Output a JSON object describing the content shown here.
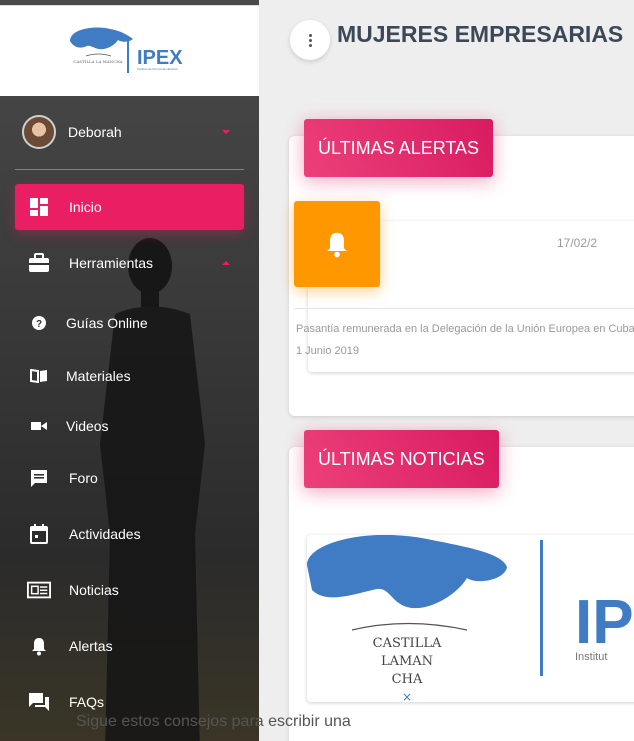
{
  "brand": {
    "logo_text": "IPEX",
    "logo_subtitle": "Instituto de Promoción Exterior",
    "logo_region": "CASTILLA LA MANCHA"
  },
  "user": {
    "name": "Deborah"
  },
  "sidebar": {
    "items": [
      {
        "label": "Inicio",
        "icon": "dashboard-icon",
        "active": true
      },
      {
        "label": "Herramientas",
        "icon": "briefcase-icon",
        "expanded": true
      },
      {
        "label": "Guías Online",
        "icon": "help-circle-icon"
      },
      {
        "label": "Materiales",
        "icon": "book-icon"
      },
      {
        "label": "Videos",
        "icon": "videocam-icon"
      },
      {
        "label": "Foro",
        "icon": "forum-icon"
      },
      {
        "label": "Actividades",
        "icon": "calendar-icon"
      },
      {
        "label": "Noticias",
        "icon": "newspaper-icon"
      },
      {
        "label": "Alertas",
        "icon": "bell-icon"
      },
      {
        "label": "FAQs",
        "icon": "chat-icon"
      }
    ]
  },
  "header": {
    "title": "MUJERES EMPRESARIAS"
  },
  "alerts": {
    "title": "ÚLTIMAS ALERTAS",
    "date": "17/02/2",
    "text": "Pasantía remunerada en la Delegación de la Unión Europea en Cuba 1 Junio 2019"
  },
  "news": {
    "title": "ÚLTIMAS NOTICIAS",
    "image_region_lines": [
      "CASTILLA",
      "LAMAN",
      "CHA"
    ],
    "image_brand": "IPEX",
    "image_brand_sub": "Institut",
    "text": "Sigue estos consejos para escribir una"
  },
  "colors": {
    "accent": "#e91e63",
    "warning": "#ff9800",
    "logo_blue": "#3f7cc4"
  }
}
